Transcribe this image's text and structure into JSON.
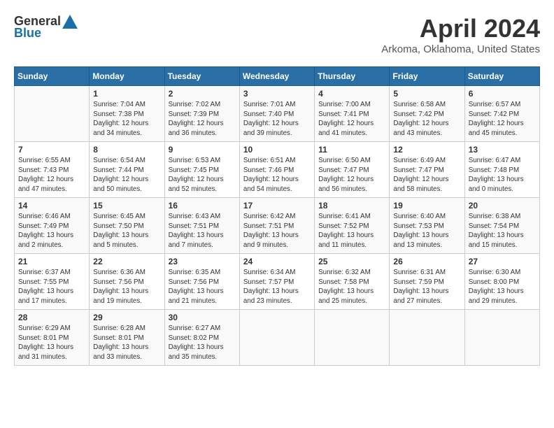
{
  "header": {
    "logo_general": "General",
    "logo_blue": "Blue",
    "title": "April 2024",
    "location": "Arkoma, Oklahoma, United States"
  },
  "weekdays": [
    "Sunday",
    "Monday",
    "Tuesday",
    "Wednesday",
    "Thursday",
    "Friday",
    "Saturday"
  ],
  "weeks": [
    [
      {
        "day": "",
        "sunrise": "",
        "sunset": "",
        "daylight": ""
      },
      {
        "day": "1",
        "sunrise": "Sunrise: 7:04 AM",
        "sunset": "Sunset: 7:38 PM",
        "daylight": "Daylight: 12 hours and 34 minutes."
      },
      {
        "day": "2",
        "sunrise": "Sunrise: 7:02 AM",
        "sunset": "Sunset: 7:39 PM",
        "daylight": "Daylight: 12 hours and 36 minutes."
      },
      {
        "day": "3",
        "sunrise": "Sunrise: 7:01 AM",
        "sunset": "Sunset: 7:40 PM",
        "daylight": "Daylight: 12 hours and 39 minutes."
      },
      {
        "day": "4",
        "sunrise": "Sunrise: 7:00 AM",
        "sunset": "Sunset: 7:41 PM",
        "daylight": "Daylight: 12 hours and 41 minutes."
      },
      {
        "day": "5",
        "sunrise": "Sunrise: 6:58 AM",
        "sunset": "Sunset: 7:42 PM",
        "daylight": "Daylight: 12 hours and 43 minutes."
      },
      {
        "day": "6",
        "sunrise": "Sunrise: 6:57 AM",
        "sunset": "Sunset: 7:42 PM",
        "daylight": "Daylight: 12 hours and 45 minutes."
      }
    ],
    [
      {
        "day": "7",
        "sunrise": "Sunrise: 6:55 AM",
        "sunset": "Sunset: 7:43 PM",
        "daylight": "Daylight: 12 hours and 47 minutes."
      },
      {
        "day": "8",
        "sunrise": "Sunrise: 6:54 AM",
        "sunset": "Sunset: 7:44 PM",
        "daylight": "Daylight: 12 hours and 50 minutes."
      },
      {
        "day": "9",
        "sunrise": "Sunrise: 6:53 AM",
        "sunset": "Sunset: 7:45 PM",
        "daylight": "Daylight: 12 hours and 52 minutes."
      },
      {
        "day": "10",
        "sunrise": "Sunrise: 6:51 AM",
        "sunset": "Sunset: 7:46 PM",
        "daylight": "Daylight: 12 hours and 54 minutes."
      },
      {
        "day": "11",
        "sunrise": "Sunrise: 6:50 AM",
        "sunset": "Sunset: 7:47 PM",
        "daylight": "Daylight: 12 hours and 56 minutes."
      },
      {
        "day": "12",
        "sunrise": "Sunrise: 6:49 AM",
        "sunset": "Sunset: 7:47 PM",
        "daylight": "Daylight: 12 hours and 58 minutes."
      },
      {
        "day": "13",
        "sunrise": "Sunrise: 6:47 AM",
        "sunset": "Sunset: 7:48 PM",
        "daylight": "Daylight: 13 hours and 0 minutes."
      }
    ],
    [
      {
        "day": "14",
        "sunrise": "Sunrise: 6:46 AM",
        "sunset": "Sunset: 7:49 PM",
        "daylight": "Daylight: 13 hours and 2 minutes."
      },
      {
        "day": "15",
        "sunrise": "Sunrise: 6:45 AM",
        "sunset": "Sunset: 7:50 PM",
        "daylight": "Daylight: 13 hours and 5 minutes."
      },
      {
        "day": "16",
        "sunrise": "Sunrise: 6:43 AM",
        "sunset": "Sunset: 7:51 PM",
        "daylight": "Daylight: 13 hours and 7 minutes."
      },
      {
        "day": "17",
        "sunrise": "Sunrise: 6:42 AM",
        "sunset": "Sunset: 7:51 PM",
        "daylight": "Daylight: 13 hours and 9 minutes."
      },
      {
        "day": "18",
        "sunrise": "Sunrise: 6:41 AM",
        "sunset": "Sunset: 7:52 PM",
        "daylight": "Daylight: 13 hours and 11 minutes."
      },
      {
        "day": "19",
        "sunrise": "Sunrise: 6:40 AM",
        "sunset": "Sunset: 7:53 PM",
        "daylight": "Daylight: 13 hours and 13 minutes."
      },
      {
        "day": "20",
        "sunrise": "Sunrise: 6:38 AM",
        "sunset": "Sunset: 7:54 PM",
        "daylight": "Daylight: 13 hours and 15 minutes."
      }
    ],
    [
      {
        "day": "21",
        "sunrise": "Sunrise: 6:37 AM",
        "sunset": "Sunset: 7:55 PM",
        "daylight": "Daylight: 13 hours and 17 minutes."
      },
      {
        "day": "22",
        "sunrise": "Sunrise: 6:36 AM",
        "sunset": "Sunset: 7:56 PM",
        "daylight": "Daylight: 13 hours and 19 minutes."
      },
      {
        "day": "23",
        "sunrise": "Sunrise: 6:35 AM",
        "sunset": "Sunset: 7:56 PM",
        "daylight": "Daylight: 13 hours and 21 minutes."
      },
      {
        "day": "24",
        "sunrise": "Sunrise: 6:34 AM",
        "sunset": "Sunset: 7:57 PM",
        "daylight": "Daylight: 13 hours and 23 minutes."
      },
      {
        "day": "25",
        "sunrise": "Sunrise: 6:32 AM",
        "sunset": "Sunset: 7:58 PM",
        "daylight": "Daylight: 13 hours and 25 minutes."
      },
      {
        "day": "26",
        "sunrise": "Sunrise: 6:31 AM",
        "sunset": "Sunset: 7:59 PM",
        "daylight": "Daylight: 13 hours and 27 minutes."
      },
      {
        "day": "27",
        "sunrise": "Sunrise: 6:30 AM",
        "sunset": "Sunset: 8:00 PM",
        "daylight": "Daylight: 13 hours and 29 minutes."
      }
    ],
    [
      {
        "day": "28",
        "sunrise": "Sunrise: 6:29 AM",
        "sunset": "Sunset: 8:01 PM",
        "daylight": "Daylight: 13 hours and 31 minutes."
      },
      {
        "day": "29",
        "sunrise": "Sunrise: 6:28 AM",
        "sunset": "Sunset: 8:01 PM",
        "daylight": "Daylight: 13 hours and 33 minutes."
      },
      {
        "day": "30",
        "sunrise": "Sunrise: 6:27 AM",
        "sunset": "Sunset: 8:02 PM",
        "daylight": "Daylight: 13 hours and 35 minutes."
      },
      {
        "day": "",
        "sunrise": "",
        "sunset": "",
        "daylight": ""
      },
      {
        "day": "",
        "sunrise": "",
        "sunset": "",
        "daylight": ""
      },
      {
        "day": "",
        "sunrise": "",
        "sunset": "",
        "daylight": ""
      },
      {
        "day": "",
        "sunrise": "",
        "sunset": "",
        "daylight": ""
      }
    ]
  ]
}
